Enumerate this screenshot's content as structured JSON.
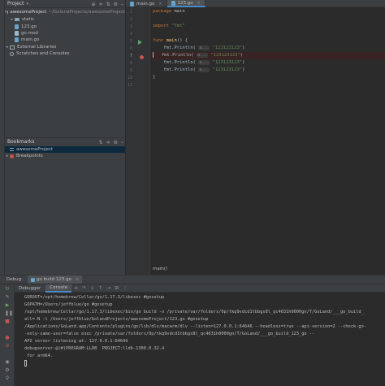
{
  "project": {
    "title": "Project",
    "root_name": "awesomeProject",
    "root_path": "~/GolandProjects/awesomeProject",
    "items": [
      {
        "label": "static",
        "kind": "folder"
      },
      {
        "label": "123.go",
        "kind": "go"
      },
      {
        "label": "go.mod",
        "kind": "mod"
      },
      {
        "label": "main.go",
        "kind": "go"
      }
    ],
    "external_libraries": "External Libraries",
    "scratches": "Scratches and Consoles"
  },
  "bookmarks": {
    "title": "Bookmarks",
    "items": [
      {
        "label": "awesomeProject"
      },
      {
        "label": "Breakpoints"
      }
    ]
  },
  "editor": {
    "tabs": [
      {
        "label": "main.go",
        "active": false
      },
      {
        "label": "123.go",
        "active": true
      }
    ],
    "line_numbers": [
      "1",
      "2",
      "3",
      "4",
      "5",
      "6",
      "7",
      "8",
      "9",
      "10",
      "11"
    ],
    "code": {
      "l1_kw": "package",
      "l1_name": "main",
      "l3_kw": "import",
      "l3_str": "\"fmt\"",
      "l5_kw": "func",
      "l5_fn": "main",
      "l5_rest": "() {",
      "call": "fmt.Println(",
      "hint": "a...",
      "arg": "\"123123123\"",
      "close_paren": ")",
      "l10": "}"
    },
    "breadcrumb": "main()"
  },
  "debug": {
    "label": "Debug:",
    "config_name": "go build 123.go",
    "tabs": [
      {
        "label": "Debugger",
        "active": false
      },
      {
        "label": "Console",
        "active": true
      }
    ],
    "console_lines": [
      "GOROOT=/opt/homebrew/Cellar/go/1.17.3/libexec #gosetup",
      "GOPATH=/Users/jeffblue/go #gosetup",
      "/opt/homebrew/Cellar/go/1.17.3/libexec/bin/go build -o /private/var/folders/0p/tkq9vdcd1tbbgs8l_qc4631h0000gn/T/GoLand/___go_build_",
      "all=-N -l /Users/jeffblue/GolandProjects/awesomeProject/123.go #gosetup",
      "/Applications/GoLand.app/Contents/plugins/go/lib/dlv/macarm/dlv --listen=127.0.0.1:64646 --headless=true --api-version=2 --check-go-",
      "-only-same-user=false exec /private/var/folders/0p/tkq9vdcd1tbbgs8l_qc4631h0000gn/T/GoLand/___go_build_123_go --",
      "API server listening at: 127.0.0.1:64646",
      "debugserver-@(#)PROGRAM:LLDB  PROJECT:lldb-1300.0.32.4",
      " for arm64."
    ]
  }
}
